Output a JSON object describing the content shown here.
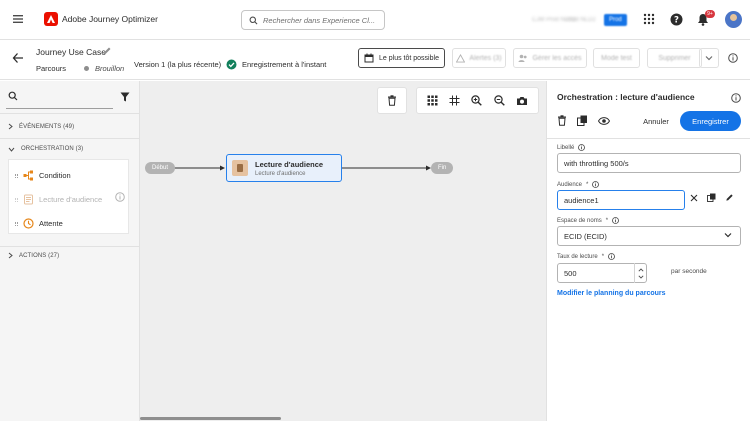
{
  "app": {
    "name": "Adobe Journey Optimizer"
  },
  "topbar": {
    "search_placeholder": "Rechercher dans Experience Cl...",
    "org_primary": "CJM Prod NLD2",
    "org_secondary": "Prod NLD2",
    "org_badge": "Prod",
    "notification_count": "9+"
  },
  "journey": {
    "title": "Journey Use Case",
    "type": "Parcours",
    "status": "Brouillon",
    "version": "Version 1 (la plus récente)",
    "save_state": "Enregistrement à l'instant"
  },
  "header_buttons": {
    "schedule": "Le plus tôt possible",
    "alerts": "Alertes (3)",
    "access": "Gérer les accès",
    "test": "Mode test",
    "delete": "Supprimer"
  },
  "palette": {
    "events": "ÉVÉNEMENTS (49)",
    "orchestration": "ORCHESTRATION (3)",
    "orchestration_items": [
      "Condition",
      "Lecture d'audience",
      "Attente"
    ],
    "actions": "ACTIONS (27)"
  },
  "canvas": {
    "start": "Début",
    "end": "Fin",
    "node_title": "Lecture d'audience",
    "node_subtitle": "Lecture d'audience"
  },
  "panel": {
    "title": "Orchestration : lecture d'audience",
    "cancel": "Annuler",
    "save": "Enregistrer",
    "label_label": "Libellé",
    "label_value": "with throttling 500/s",
    "audience_label": "Audience",
    "audience_value": "audience1",
    "namespace_label": "Espace de noms",
    "namespace_value": "ECID (ECID)",
    "rate_label": "Taux de lecture",
    "rate_value": "500",
    "rate_unit": "par seconde",
    "schedule_link": "Modifier le planning du parcours"
  },
  "colors": {
    "accent": "#1473e6",
    "brand": "#eb1000",
    "success": "#12805c",
    "node_border": "#2680eb"
  }
}
